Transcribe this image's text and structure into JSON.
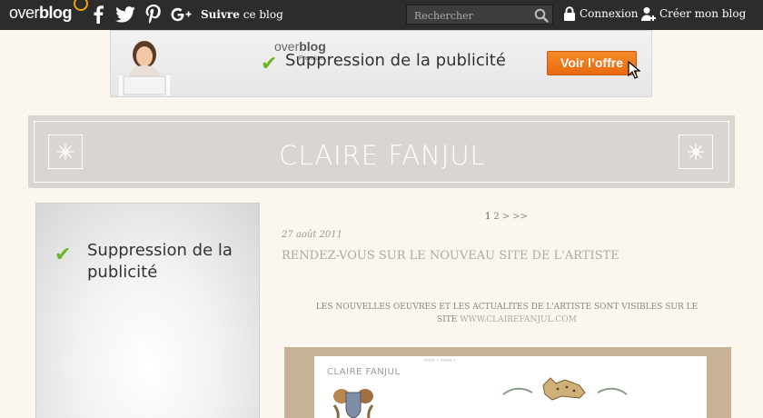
{
  "topbar": {
    "logo_text": "over",
    "logo_bold": "blog",
    "follow_bold": "Suivre",
    "follow_rest": "ce blog",
    "search_placeholder": "Rechercher",
    "login_label": "Connexion",
    "create_label": "Créer mon blog",
    "social": [
      {
        "name": "facebook-icon",
        "glyph": "f"
      },
      {
        "name": "twitter-icon",
        "glyph": "t"
      },
      {
        "name": "pinterest-icon",
        "glyph": "P"
      },
      {
        "name": "google-plus-icon",
        "glyph": "g+"
      }
    ]
  },
  "ad": {
    "brand": "over",
    "brand_bold": "blog",
    "premium": "Premium",
    "text": "Suppression de la publicité",
    "button": "Voir l’offre",
    "accent": "#f0821e",
    "check_color": "#6bb52b"
  },
  "header": {
    "title": "CLAIRE FANJUL"
  },
  "sidebar": {
    "text": "Suppression de la publicité"
  },
  "pager": {
    "current": "1",
    "next_page": "2",
    "next": ">",
    "last": ">>"
  },
  "post": {
    "date": "27 août 2011",
    "title": "RENDEZ-VOUS SUR LE NOUVEAU SITE DE L'ARTISTE",
    "body_line1": "LES NOUVELLES OEUVRES ET LES ACTUALITES DE L'ARTISTE SONT VISIBLES SUR LE",
    "body_site": "SITE",
    "body_link": "WWW.CLAIREFANJUL.COM",
    "image": {
      "title": "CLAIRE FANJUL",
      "nav": "intro  •  news  •"
    }
  },
  "colors": {
    "topbar": "#2c2c2c",
    "page_bg": "#fbf6ee",
    "header_bg": "#d9d5d1",
    "frame": "#c7b197"
  }
}
